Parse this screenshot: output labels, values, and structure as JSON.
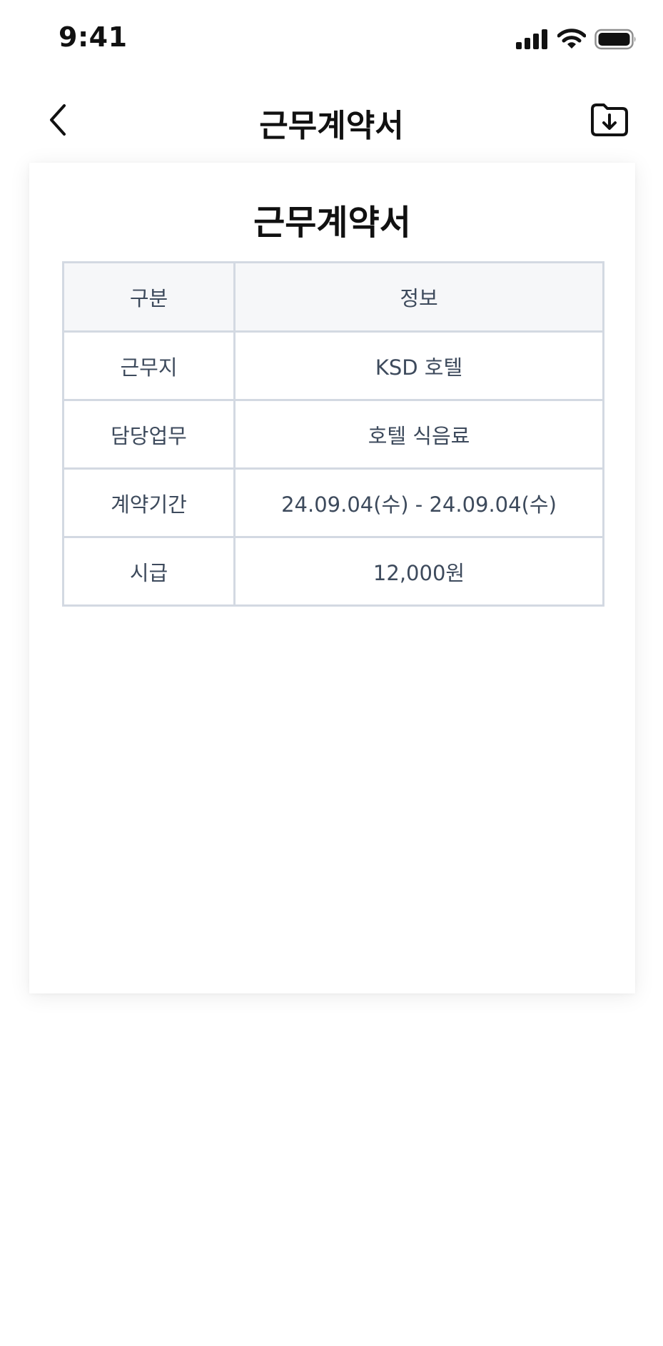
{
  "status_bar": {
    "time": "9:41",
    "icons": [
      "cellular-signal-icon",
      "wifi-icon",
      "battery-icon"
    ]
  },
  "nav": {
    "title": "근무계약서",
    "back_icon": "chevron-left-icon",
    "download_icon": "folder-download-icon"
  },
  "document": {
    "title": "근무계약서",
    "table": {
      "headers": [
        "구분",
        "정보"
      ],
      "rows": [
        {
          "label": "근무지",
          "value": "KSD 호텔"
        },
        {
          "label": "담당업무",
          "value": "호텔 식음료"
        },
        {
          "label": "계약기간",
          "value": "24.09.04(수) - 24.09.04(수)"
        },
        {
          "label": "시급",
          "value": "12,000원"
        }
      ]
    }
  },
  "colors": {
    "text_primary": "#111111",
    "table_text": "#3d4a5c",
    "table_border": "#d3d9e2",
    "table_header_bg": "#f6f7f9"
  }
}
